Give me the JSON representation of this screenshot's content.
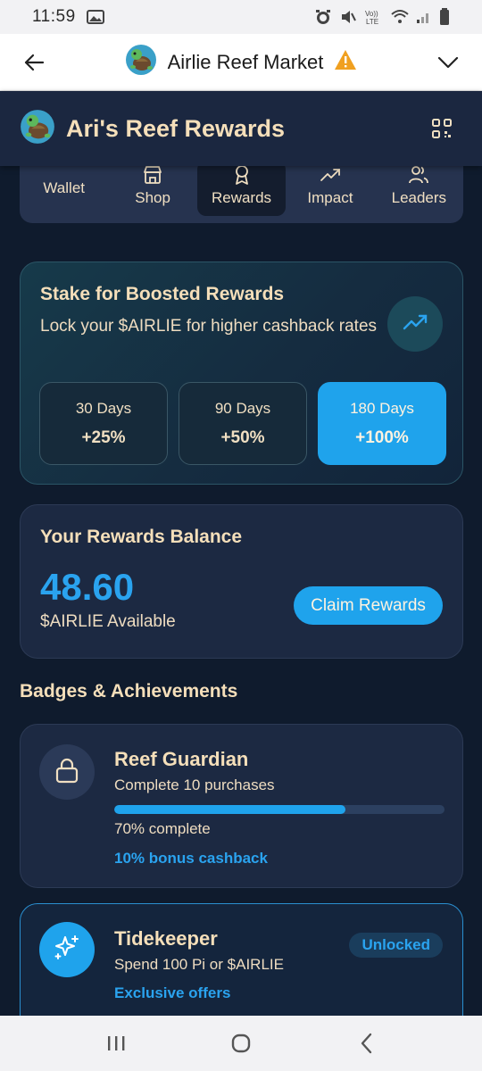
{
  "status_bar": {
    "time": "11:59"
  },
  "browser": {
    "title": "Airlie Reef Market"
  },
  "app": {
    "title": "Ari's Reef Rewards"
  },
  "tabs": [
    {
      "label": "Wallet",
      "icon": "wallet-icon",
      "active": false
    },
    {
      "label": "Shop",
      "icon": "store-icon",
      "active": false
    },
    {
      "label": "Rewards",
      "icon": "award-icon",
      "active": true
    },
    {
      "label": "Impact",
      "icon": "trending-up-icon",
      "active": false
    },
    {
      "label": "Leaders",
      "icon": "users-icon",
      "active": false
    }
  ],
  "stake": {
    "title": "Stake for Boosted Rewards",
    "subtitle": "Lock your $AIRLIE for higher cashback rates",
    "options": [
      {
        "days": "30 Days",
        "pct": "+25%",
        "selected": false
      },
      {
        "days": "90 Days",
        "pct": "+50%",
        "selected": false
      },
      {
        "days": "180 Days",
        "pct": "+100%",
        "selected": true
      }
    ]
  },
  "balance": {
    "title": "Your Rewards Balance",
    "amount": "48.60",
    "sub": "$AIRLIE Available",
    "claim_label": "Claim Rewards"
  },
  "badges_section": {
    "title": "Badges & Achievements"
  },
  "badges": [
    {
      "name": "Reef Guardian",
      "desc": "Complete 10 purchases",
      "progress": 0.7,
      "progress_text": "70% complete",
      "bonus": "10% bonus cashback",
      "icon": "lock-icon"
    },
    {
      "name": "Tidekeeper",
      "desc": "Spend 100 Pi or $AIRLIE",
      "bonus": "Exclusive offers",
      "status": "Unlocked",
      "icon": "sparkles-icon"
    }
  ],
  "colors": {
    "background": "#0f1b2d",
    "card": "#1c2942",
    "accent": "#1fa3ec",
    "text": "#f5dfba"
  }
}
